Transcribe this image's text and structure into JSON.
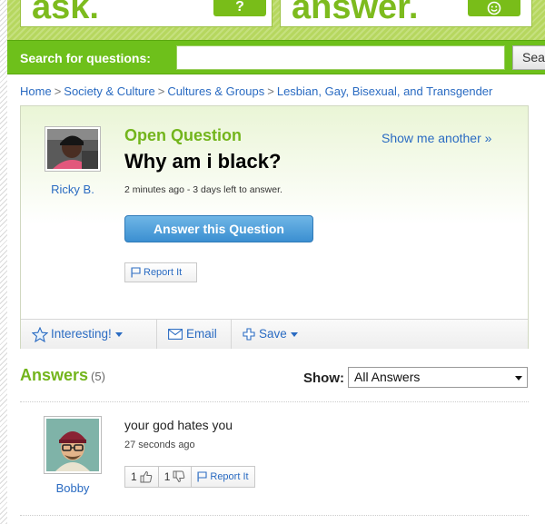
{
  "banner": {
    "ask_word": "ask.",
    "ask_badge": "?",
    "answer_word": "answer.",
    "answer_badge": ":-)"
  },
  "search": {
    "label": "Search for questions:",
    "value": "",
    "placeholder": "",
    "button_label": "Search"
  },
  "breadcrumb": [
    "Home",
    "Society & Culture",
    "Cultures & Groups",
    "Lesbian, Gay, Bisexual, and Transgender"
  ],
  "question": {
    "status": "Open Question",
    "show_another": "Show me another »",
    "title": "Why am i black?",
    "meta": "2 minutes ago - 3 days left to answer.",
    "asker_name": "Ricky B.",
    "answer_button": "Answer this Question",
    "report_label": "Report It"
  },
  "actions": {
    "interesting": "Interesting!",
    "email": "Email",
    "save": "Save"
  },
  "answers": {
    "title": "Answers",
    "count": "(5)",
    "show_label": "Show:",
    "show_selected": "All Answers",
    "items": [
      {
        "author": "Bobby",
        "text": "your god hates you",
        "time": "27 seconds ago",
        "thumbs_up": "1",
        "thumbs_down": "1",
        "report_label": "Report It"
      }
    ]
  },
  "colors": {
    "brand_green": "#73b51c",
    "link_blue": "#2a6bc2",
    "button_blue": "#3b8fd1"
  },
  "icons": [
    "star-icon",
    "envelope-icon",
    "plus-icon",
    "flag-icon",
    "thumbs-up-icon",
    "thumbs-down-icon"
  ]
}
